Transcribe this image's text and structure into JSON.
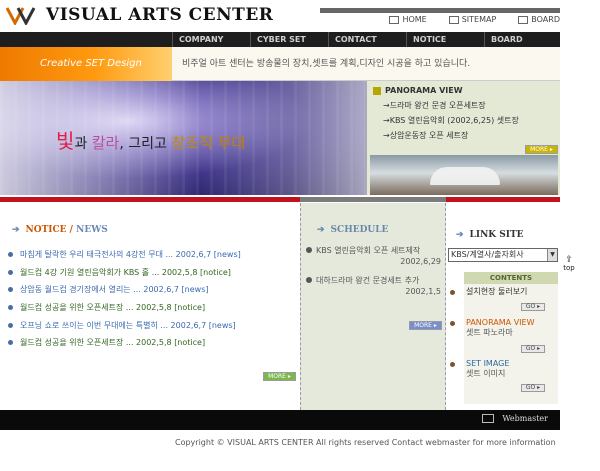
{
  "header": {
    "logo_text": "VISUAL ARTS CENTER",
    "top_links": [
      "HOME",
      "SITEMAP",
      "BOARD"
    ]
  },
  "nav": {
    "items": [
      "COMPANY",
      "CYBER SET",
      "CONTACT",
      "NOTICE",
      "BOARD"
    ]
  },
  "banner": {
    "creative_label": "Creative SET Design",
    "intro": "비주얼 아트 센터는 방송물의 장치,셋트를 계획,디자인 시공을 하고 있습니다."
  },
  "hero": {
    "w1": "빛",
    "w2": "과 ",
    "w3": "칼라",
    "w4": ", 그리고 ",
    "w5": "창조적",
    "w6": " 무대"
  },
  "panorama": {
    "title": "PANORAMA VIEW",
    "items": [
      "드라마 왕건 문경 오픈세트장",
      "KBS 열린음악회 (2002,6,25) 셋트장",
      "상암운동장 오픈 세트장"
    ],
    "more": "MORE ▸"
  },
  "notice": {
    "title_a": "NOTICE / ",
    "title_b": "NEWS",
    "items": [
      {
        "text": "마침게 탈락한 우리 태극전사의 4강전 무대 ... 2002,6,7 [news]"
      },
      {
        "text": "월드컵 4강 기원 열린음악회가 KBS 홀 ... 2002,5,8 [notice]"
      },
      {
        "text": "상암동 월드컵 경기장에서 열리는 ... 2002,6,7 [news]"
      },
      {
        "text": "월드컵 성공을 위한 오픈세트장 ... 2002,5,8 [notice]"
      },
      {
        "text": "오프닝 쇼로 쓰이는 이번 무대에는 특별히 ... 2002,6,7 [news]"
      },
      {
        "text": "월드컵 성공을 위한 오픈세트장 ... 2002,5,8 [notice]"
      }
    ],
    "more": "MORE ▸"
  },
  "schedule": {
    "title": "SCHEDULE",
    "items": [
      {
        "text": "KBS 열린음악회 오픈 세트제작",
        "date": "2002,6,29"
      },
      {
        "text": "대하드라마 왕건 문경세트 추가",
        "date": "2002,1,5"
      }
    ],
    "more": "MORE ▸"
  },
  "link_site": {
    "title": "LINK SITE",
    "select_value": "KBS/계열사/출자회사",
    "top_label": "top"
  },
  "contents": {
    "title": "CONTENTS",
    "item1": "설치현장 둘러보기",
    "item2_en": "PANORAMA VIEW",
    "item2_ko": "셋트 파노라마",
    "item3_en": "SET IMAGE",
    "item3_ko": "셋트 이미지",
    "go": "GO ▸"
  },
  "footer": {
    "webmaster": "Webmaster",
    "copyright": "Copyright © VISUAL ARTS CENTER All rights reserved Contact webmaster for more information"
  }
}
